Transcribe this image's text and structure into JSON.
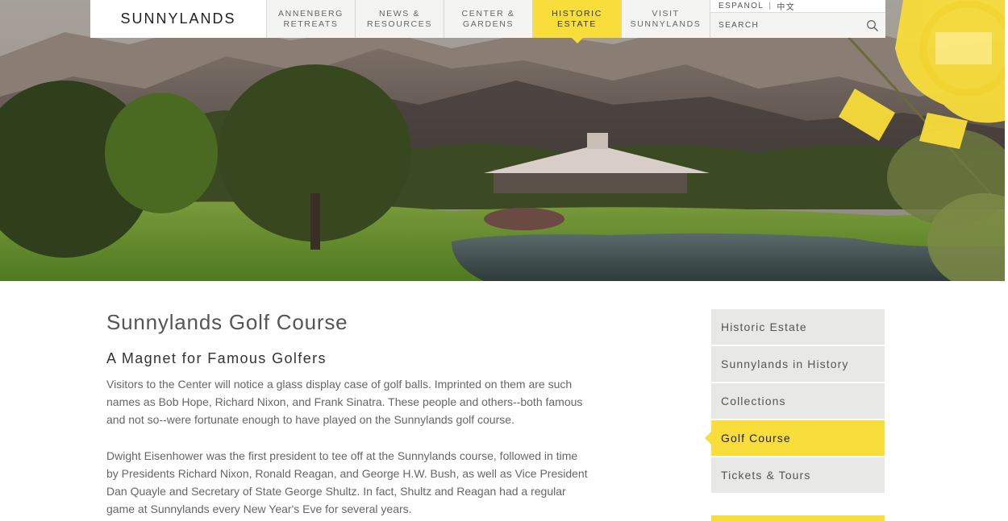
{
  "header": {
    "logo": "SUNNYLANDS",
    "nav": [
      {
        "line1": "ANNENBERG",
        "line2": "RETREATS"
      },
      {
        "line1": "NEWS &",
        "line2": "RESOURCES"
      },
      {
        "line1": "CENTER &",
        "line2": "GARDENS"
      },
      {
        "line1": "HISTORIC",
        "line2": "ESTATE"
      },
      {
        "line1": "VISIT",
        "line2": "SUNNYLANDS"
      }
    ],
    "active_nav": "HISTORIC ESTATE",
    "languages": [
      "ESPANOL",
      "中文"
    ],
    "search_placeholder": "SEARCH"
  },
  "main": {
    "title": "Sunnylands Golf Course",
    "subtitle": "A Magnet for Famous Golfers",
    "paragraphs": [
      "Visitors to the Center will notice a glass display case of golf balls. Imprinted on them are such names as Bob Hope, Richard Nixon, and Frank Sinatra. These people and others--both famous and not so--were fortunate enough to have played on the Sunnylands golf course.",
      "Dwight Eisenhower was the first president to tee off at the Sunnylands course, followed in time by Presidents Richard Nixon, Ronald Reagan, and George H.W. Bush, as well as Vice President Dan Quayle and Secretary of State George Shultz. In fact, Shultz and Reagan had a regular game at Sunnylands every New Year's Eve for several years."
    ]
  },
  "sidebar": {
    "items": [
      {
        "label": "Historic Estate"
      },
      {
        "label": "Sunnylands in History"
      },
      {
        "label": "Collections"
      },
      {
        "label": "Golf Course"
      },
      {
        "label": "Tickets & Tours"
      }
    ],
    "active": "Golf Course"
  },
  "colors": {
    "accent_yellow": "#f9dd3a",
    "nav_bg": "#f4f4f2",
    "sidebar_bg": "#e8e8e6"
  }
}
